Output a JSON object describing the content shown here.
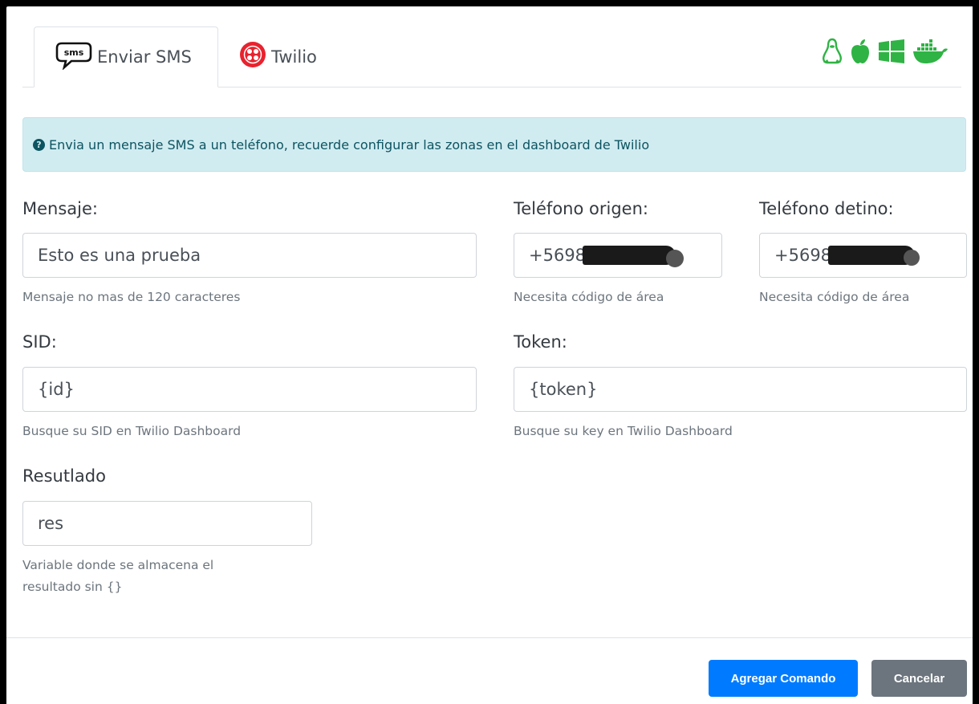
{
  "tabs": [
    {
      "label": "Enviar SMS",
      "icon": "sms-bubble-icon"
    },
    {
      "label": "Twilio",
      "icon": "twilio-logo-icon"
    }
  ],
  "os_icons": [
    "linux-icon",
    "apple-icon",
    "windows-icon",
    "docker-icon"
  ],
  "alert": {
    "text": "Envia un mensaje SMS a un teléfono, recuerde configurar las zonas en el dashboard de Twilio"
  },
  "fields": {
    "mensaje": {
      "label": "Mensaje:",
      "value": "Esto es una prueba",
      "help": "Mensaje no mas de 120 caracteres"
    },
    "origen": {
      "label": "Teléfono origen:",
      "value": "+5698",
      "help": "Necesita código de área"
    },
    "destino": {
      "label": "Teléfono detino:",
      "value": "+5698",
      "help": "Necesita código de área"
    },
    "sid": {
      "label": "SID:",
      "value": "{id}",
      "help": "Busque su SID en Twilio Dashboard"
    },
    "token": {
      "label": "Token:",
      "value": "{token}",
      "help": "Busque su key en Twilio Dashboard"
    },
    "resultado": {
      "label": "Resutlado",
      "value": "res",
      "help_line1": "Variable donde se almacena el",
      "help_line2": "resultado sin {}"
    }
  },
  "buttons": {
    "submit": "Agregar Comando",
    "cancel": "Cancelar"
  },
  "colors": {
    "os_icon": "#2fb344",
    "primary": "#007bff",
    "secondary": "#6c757d",
    "alert_bg": "#d1ecf1",
    "twilio": "#e8222e"
  }
}
